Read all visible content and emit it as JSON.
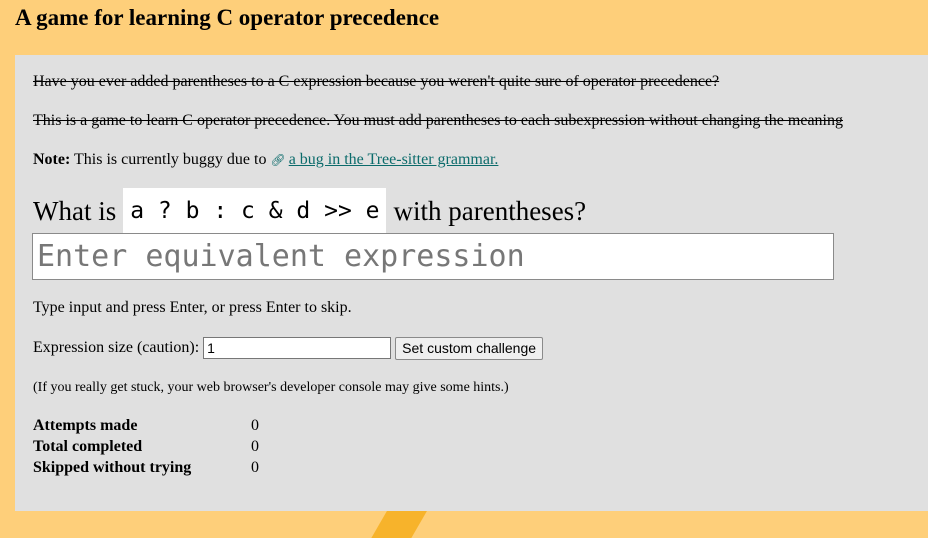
{
  "page": {
    "title": "A game for learning C operator precedence"
  },
  "intro": {
    "line1": "Have you ever added parentheses to a C expression because you weren't quite sure of operator precedence?",
    "line2": "This is a game to learn C operator precedence. You must add parentheses to each subexpression without changing the meaning"
  },
  "note": {
    "label": "Note:",
    "text": "This is currently buggy due to",
    "link_icon": "link-icon",
    "link_text": "a bug in the Tree-sitter grammar."
  },
  "challenge": {
    "prefix": "What is",
    "expression": "a ? b : c & d >> e",
    "suffix": "with parentheses?"
  },
  "answer": {
    "placeholder": "Enter equivalent expression",
    "value": ""
  },
  "instructions": "Type input and press Enter, or press Enter to skip.",
  "size_control": {
    "label": "Expression size (caution):",
    "value": "1",
    "button_label": "Set custom challenge"
  },
  "stuck_hint": "(If you really get stuck, your web browser's developer console may give some hints.)",
  "stats": [
    {
      "label": "Attempts made",
      "value": "0"
    },
    {
      "label": "Total completed",
      "value": "0"
    },
    {
      "label": "Skipped without trying",
      "value": "0"
    }
  ],
  "colors": {
    "background": "#fecf7a",
    "panel": "#e0e0e0",
    "link": "#0b6b6b"
  }
}
